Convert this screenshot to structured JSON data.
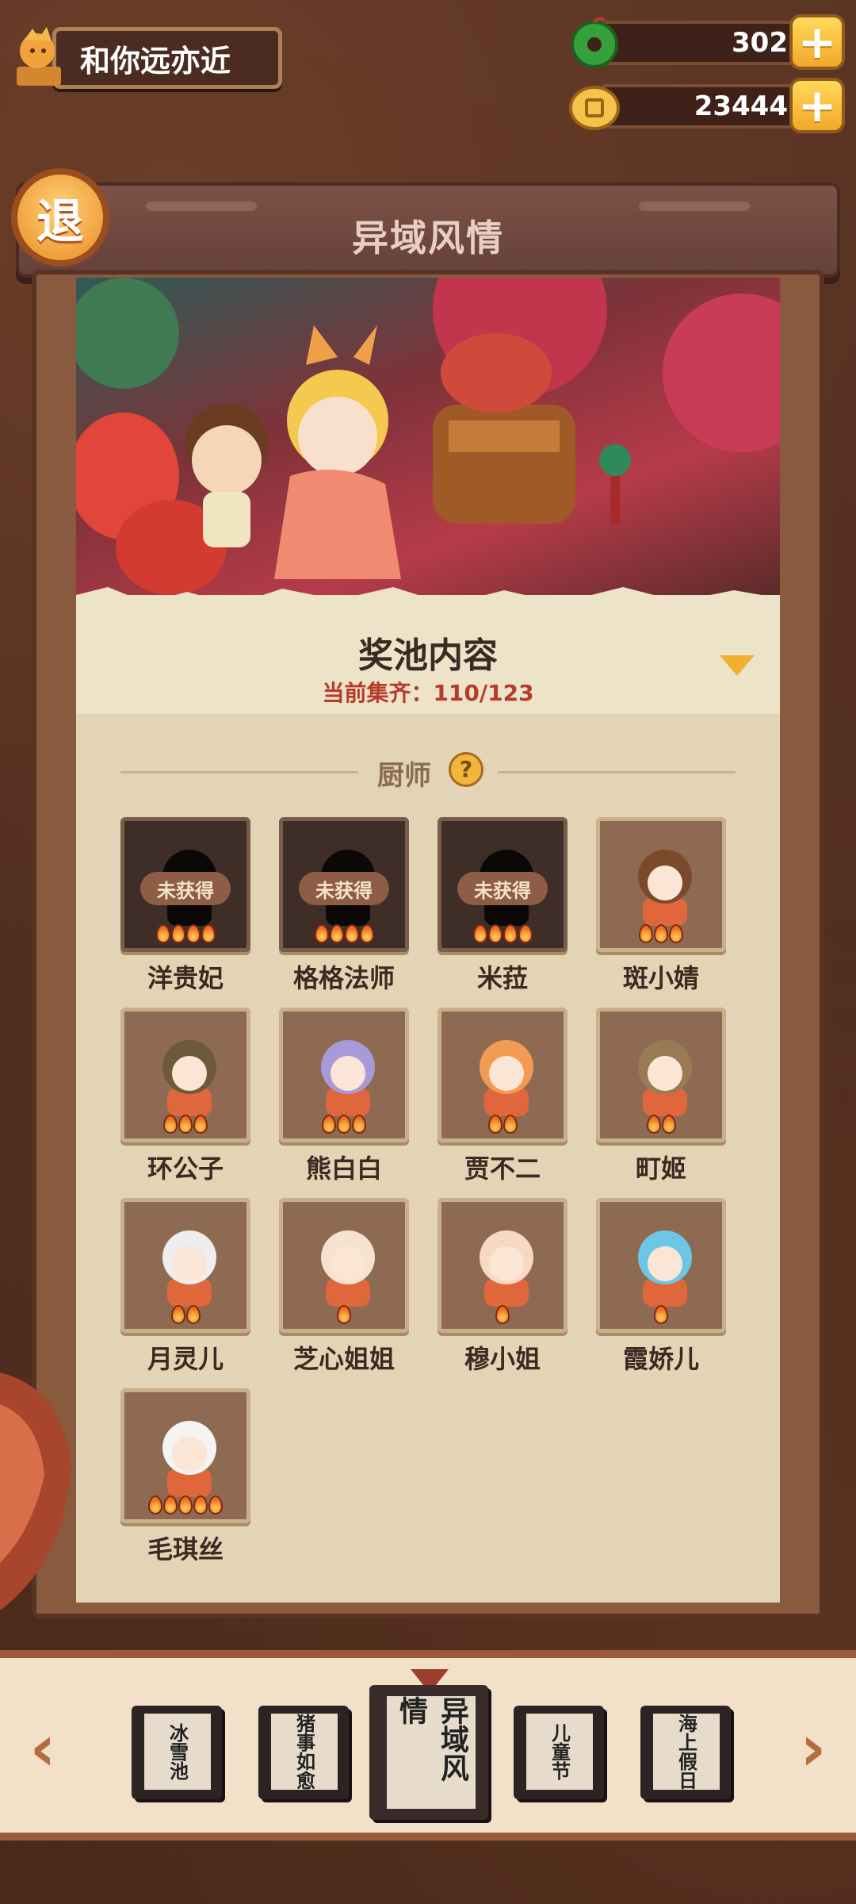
{
  "player": {
    "name": "和你远亦近"
  },
  "currencies": [
    {
      "name": "jade",
      "value": "302",
      "icon": "green-jade-icon"
    },
    {
      "name": "coin",
      "value": "23444",
      "icon": "gold-coin-icon"
    }
  ],
  "header": {
    "back_label": "退",
    "title": "异域风情"
  },
  "pool": {
    "title": "奖池内容",
    "progress": "当前集齐：110/123"
  },
  "section": {
    "label": "厨师",
    "help": "?"
  },
  "chefs": [
    {
      "name": "洋贵妃",
      "locked": true,
      "lock_label": "未获得",
      "stars": 4
    },
    {
      "name": "格格法师",
      "locked": true,
      "lock_label": "未获得",
      "stars": 4
    },
    {
      "name": "米菈",
      "locked": true,
      "lock_label": "未获得",
      "stars": 4
    },
    {
      "name": "斑小婧",
      "locked": false,
      "stars": 3
    },
    {
      "name": "环公子",
      "locked": false,
      "stars": 3
    },
    {
      "name": "熊白白",
      "locked": false,
      "stars": 3
    },
    {
      "name": "贾不二",
      "locked": false,
      "stars": 2
    },
    {
      "name": "町姬",
      "locked": false,
      "stars": 2
    },
    {
      "name": "月灵儿",
      "locked": false,
      "stars": 2
    },
    {
      "name": "芝心姐姐",
      "locked": false,
      "stars": 1
    },
    {
      "name": "穆小姐",
      "locked": false,
      "stars": 1
    },
    {
      "name": "霞娇儿",
      "locked": false,
      "stars": 1
    },
    {
      "name": "毛琪丝",
      "locked": false,
      "stars": 5
    }
  ],
  "tabs": [
    {
      "label": "冰雪池",
      "active": false
    },
    {
      "label": "猪事如愈",
      "active": false
    },
    {
      "label": "异域风情",
      "active": true
    },
    {
      "label": "儿童节",
      "active": false
    },
    {
      "label": "海上假日",
      "active": false
    }
  ],
  "nav": {
    "prev": "‹",
    "next": "›"
  },
  "colors": {
    "accent": "#f0b131",
    "brand_brown": "#4a2a1c",
    "progress_red": "#b53b2a"
  }
}
